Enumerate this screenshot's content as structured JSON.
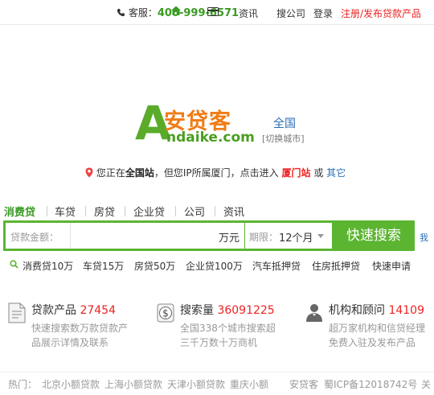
{
  "topbar": {
    "service_label": "客服：",
    "phone": "400-999-6571",
    "links": [
      {
        "label": "资讯"
      },
      {
        "label": "搜公司"
      },
      {
        "label": "登录"
      },
      {
        "label": "注册/发布贷款产品"
      }
    ]
  },
  "logo": {
    "letter": "A",
    "brand_cn": "安贷客",
    "brand_en": "ndaike.com"
  },
  "city": {
    "current": "全国",
    "switch_label": "[切换城市]"
  },
  "location": {
    "prefix": "您正在",
    "site": "全国站",
    "middle": "，但您IP所属厦门，点击进入",
    "city_site": "厦门站",
    "or": "或",
    "other": "其它"
  },
  "tabs": [
    {
      "label": "消费贷",
      "active": true
    },
    {
      "label": "车贷",
      "active": false
    },
    {
      "label": "房贷",
      "active": false
    },
    {
      "label": "企业贷",
      "active": false
    },
    {
      "label": "公司",
      "active": false
    },
    {
      "label": "资讯",
      "active": false
    }
  ],
  "search": {
    "amount_label": "贷款金额：",
    "amount_unit": "万元",
    "period_label": "期限：",
    "period_value": "12个月",
    "button": "快速搜索",
    "edge_text": "我"
  },
  "quick_links": [
    "消费贷10万",
    "车贷15万",
    "房贷50万",
    "企业贷100万",
    "汽车抵押贷",
    "住房抵押贷",
    "快速申请"
  ],
  "features": [
    {
      "title": "贷款产品",
      "number": "27454",
      "desc": "快速搜索数万款贷款产品展示详情及联系",
      "icon": "document-icon"
    },
    {
      "title": "搜索量",
      "number": "36091225",
      "desc": "全国338个城市搜索超三千万数十万商机",
      "icon": "dollar-coin-icon"
    },
    {
      "title": "机构和顾问",
      "number": "14109",
      "desc": "超万家机构和信贷经理免费入驻及发布产品",
      "icon": "user-icon"
    }
  ],
  "footer": {
    "hot_label": "热门：",
    "hot_links": [
      "北京小额贷款",
      "上海小额贷款",
      "天津小额贷款",
      "重庆小额"
    ],
    "brand": "安贷客",
    "icp": "蜀ICP备12018742号",
    "edge": "关"
  },
  "colors": {
    "brand_green": "#5cb531",
    "brand_orange": "#f07c16",
    "accent_red": "#e22222",
    "link_blue": "#2a6fb4"
  }
}
